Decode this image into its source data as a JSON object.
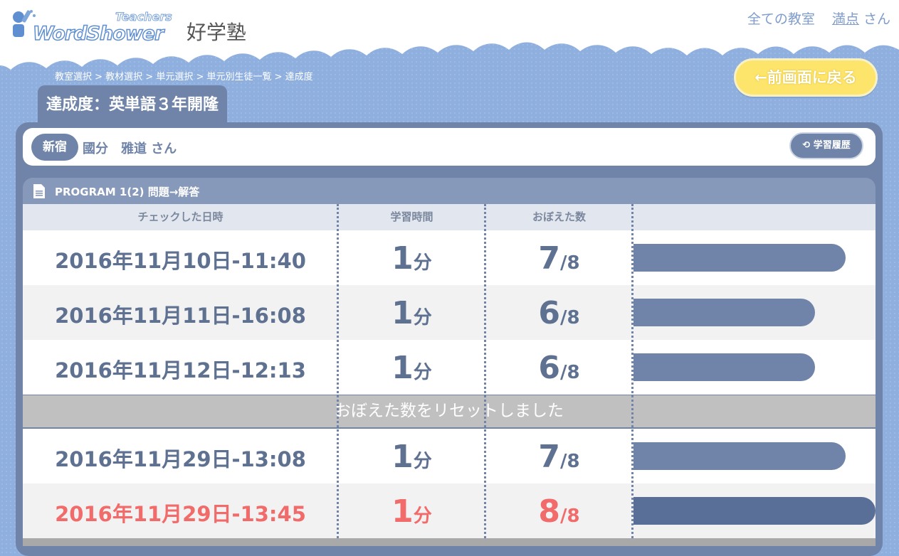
{
  "header": {
    "logo_teachers": "Teachers",
    "logo_main": "WordShower",
    "school_name": "好学塾",
    "all_classrooms_link": "全ての教室",
    "user_name": "満点",
    "user_suffix": "さん"
  },
  "breadcrumb": "教室選択 > 教材選択 > 単元選択 > 単元別生徒一覧 > 達成度",
  "back_button_label": "←前画面に戻る",
  "page_title": "達成度：英単語３年開隆",
  "student": {
    "class_badge": "新宿",
    "name": "國分　雅道 さん",
    "history_button_label": "学習履歴"
  },
  "program": {
    "title": "PROGRAM 1(2) 問題→解答",
    "columns": [
      "チェックした日時",
      "学習時間",
      "おぼえた数",
      ""
    ]
  },
  "rows": [
    {
      "date": "2016年11月10日-11:40",
      "time_value": "1",
      "time_unit": "分",
      "count": "7",
      "total": "/8",
      "fraction": 0.875
    },
    {
      "date": "2016年11月11日-16:08",
      "time_value": "1",
      "time_unit": "分",
      "count": "6",
      "total": "/8",
      "fraction": 0.75
    },
    {
      "date": "2016年11月12日-12:13",
      "time_value": "1",
      "time_unit": "分",
      "count": "6",
      "total": "/8",
      "fraction": 0.75
    }
  ],
  "reset_message": "おぼえた数をリセットしました",
  "rows_after_reset": [
    {
      "date": "2016年11月29日-13:08",
      "time_value": "1",
      "time_unit": "分",
      "count": "7",
      "total": "/8",
      "fraction": 0.875
    },
    {
      "date": "2016年11月29日-13:45",
      "time_value": "1",
      "time_unit": "分",
      "count": "8",
      "total": "/8",
      "fraction": 1.0,
      "highlight": true
    }
  ],
  "colors": {
    "accent": "#6f84a8",
    "highlight": "#f26b6b",
    "back_button": "#fde46b",
    "background": "#8fb0df"
  },
  "icons": [
    "document-icon",
    "history-icon",
    "logo-person-icon"
  ]
}
